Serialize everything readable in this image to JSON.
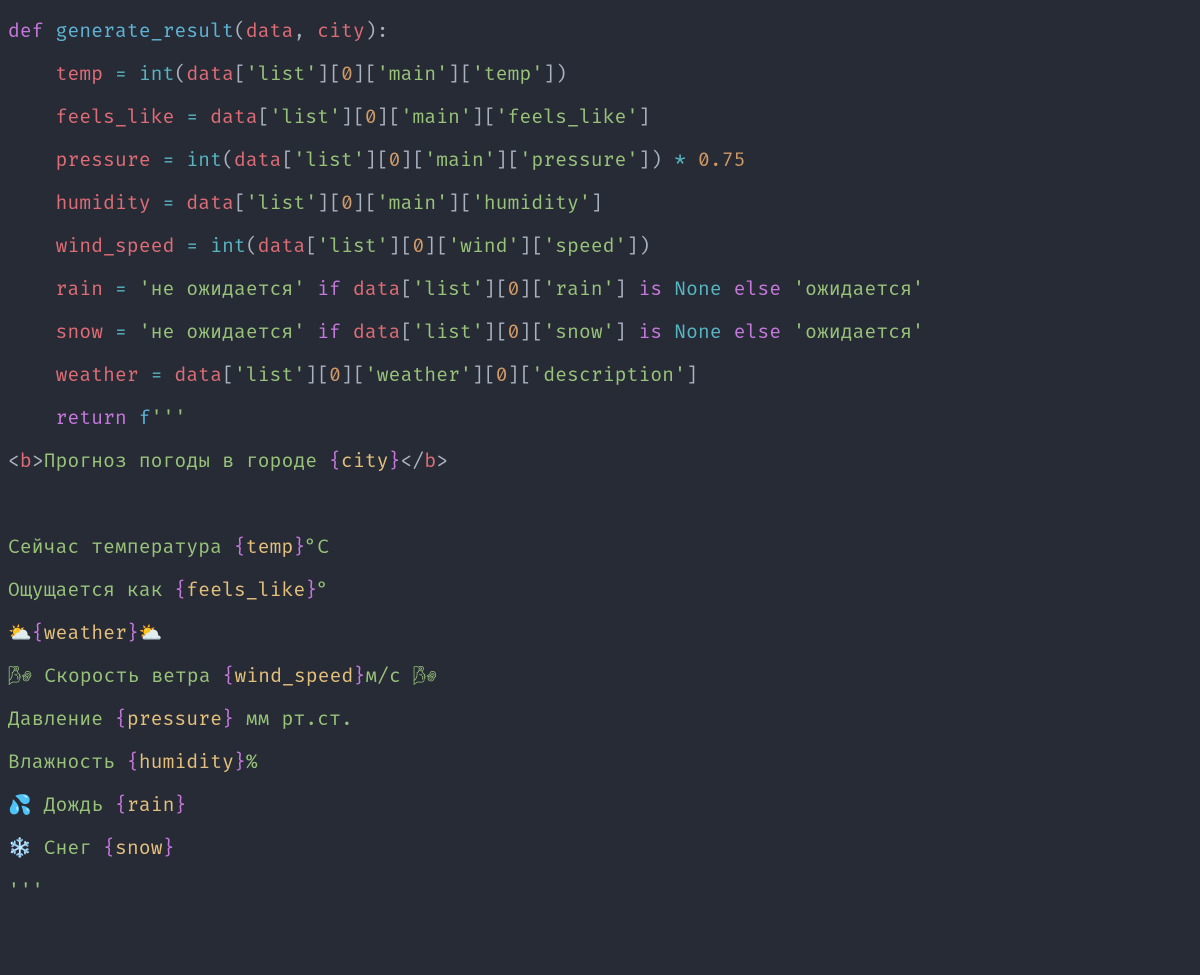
{
  "colors": {
    "background": "#262b36",
    "default": "#c0c9d9",
    "keyword": "#c678dd",
    "function": "#5fb4d6",
    "builtin": "#56b6c2",
    "identifier": "#e06c75",
    "punctuation": "#abb2bf",
    "operator": "#56b6c2",
    "string": "#98c379",
    "number": "#d19a66",
    "fstring_brace": "#c678dd",
    "fstring_var": "#e5c07b"
  },
  "keywords": {
    "def": "def",
    "return": "return",
    "if": "if",
    "is": "is",
    "else": "else"
  },
  "builtins": {
    "int": "int",
    "none": "None"
  },
  "ids": {
    "generate_result": "generate_result",
    "data": "data",
    "city": "city",
    "temp": "temp",
    "feels_like": "feels_like",
    "pressure": "pressure",
    "humidity": "humidity",
    "wind_speed": "wind_speed",
    "rain": "rain",
    "snow": "snow",
    "weather": "weather"
  },
  "strings": {
    "list": "'list'",
    "main": "'main'",
    "temp": "'temp'",
    "feels_like": "'feels_like'",
    "pressure": "'pressure'",
    "humidity": "'humidity'",
    "wind": "'wind'",
    "speed": "'speed'",
    "rain": "'rain'",
    "snow": "'snow'",
    "weather": "'weather'",
    "description": "'description'",
    "not_expected": "'не ожидается'",
    "expected": "'ожидается'"
  },
  "numbers": {
    "zero": "0",
    "mult": "0.75"
  },
  "punct": {
    "lparen": "(",
    "rparen": ")",
    "comma": ", ",
    "colon": ":",
    "lbr": "[",
    "rbr": "]",
    "assign": " = ",
    "star": " * ",
    "lt": "<",
    "gt": ">",
    "slash": "/",
    "lb": "{",
    "rb": "}",
    "triple": "'''",
    "f": "f"
  },
  "tags": {
    "b": "b"
  },
  "fstring": {
    "title_prefix": "Прогноз погоды в городе ",
    "temp_line_prefix": "Сейчас температура ",
    "temp_line_suffix": "°С",
    "feels_prefix": "Ощущается как ",
    "feels_suffix": "°",
    "weather_prefix": "⛅",
    "weather_suffix": "⛅",
    "wind_prefix": "🌬 Скорость ветра ",
    "wind_suffix": "м/с 🌬",
    "pressure_prefix": "Давление ",
    "pressure_suffix": " мм рт.ст.",
    "humidity_prefix": "Влажность ",
    "humidity_suffix": "%",
    "rain_prefix": "💦 Дождь ",
    "snow_prefix": "❄️ Снег "
  }
}
